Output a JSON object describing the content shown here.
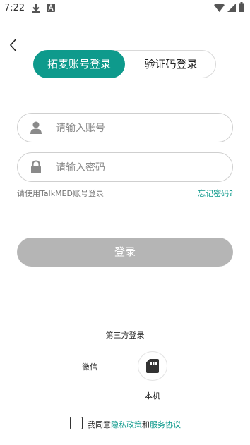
{
  "status_bar": {
    "time": "7:22"
  },
  "tabs": {
    "account_login": "拓麦账号登录",
    "code_login": "验证码登录"
  },
  "form": {
    "account_placeholder": "请输入账号",
    "password_placeholder": "请输入密码",
    "hint": "请使用TalkMED账号登录",
    "forgot": "忘记密码?",
    "submit": "登录"
  },
  "third_party": {
    "title": "第三方登录",
    "wechat": "微信",
    "local": "本机"
  },
  "agreement": {
    "prefix": "我同意",
    "privacy": "隐私政策",
    "and": "和",
    "service": "服务协议"
  },
  "colors": {
    "accent": "#0e9a8c",
    "button_disabled": "#b5b5b5"
  }
}
